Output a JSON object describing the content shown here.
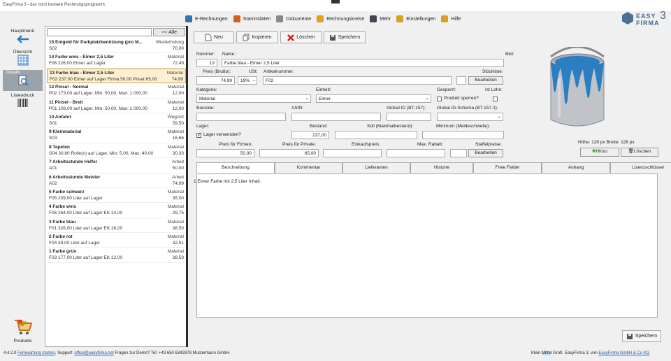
{
  "window": {
    "title": "EasyFirma 3 - das noch bessere Rechnungsprogramm"
  },
  "topmenu": [
    {
      "label": "E-Rechnungen",
      "icon": "e-invoice-icon",
      "color": "#3a6fb0"
    },
    {
      "label": "Stammdaten",
      "icon": "master-data-icon",
      "color": "#d06020"
    },
    {
      "label": "Dokumente",
      "icon": "documents-icon",
      "color": "#888"
    },
    {
      "label": "Rechnungskreise",
      "icon": "number-circle-icon",
      "color": "#e0a020"
    },
    {
      "label": "Mehr",
      "icon": "more-icon",
      "color": "#445"
    },
    {
      "label": "Einstellungen",
      "icon": "settings-icon",
      "color": "#d8a020"
    },
    {
      "label": "Hilfe",
      "icon": "help-icon",
      "color": "#d8a020"
    }
  ],
  "logo": {
    "text1": "EASY",
    "text2": "FIRMA",
    "num": "3"
  },
  "nav": {
    "hauptmenu": "Hauptmenü",
    "uebersicht": "Übersicht",
    "details": "Details",
    "listendruck": "Listendruck",
    "produkte": "Produkte"
  },
  "list": {
    "search_value": "",
    "alle_label": "Alle",
    "items": [
      {
        "title": "15 Entgeld für Parkplatzbenützung (pro M...",
        "cat": "Wiederholung",
        "desc": "S02",
        "price": "70,00"
      },
      {
        "title": "14 Farbe weis - Eimer 2,5 Liter",
        "cat": "Material",
        "desc": "F06 226,00 Eimer auf Lager",
        "price": "72,49"
      },
      {
        "title": "13 Farbe blau - Eimer 2,5 Liter",
        "cat": "Material",
        "desc": "F02 237,00 Eimer auf Lager Firma 50,00   Privat 65,00",
        "price": "74,99",
        "selected": true
      },
      {
        "title": "12 Pinsel - Normal",
        "cat": "Material",
        "desc": "P02 173,00 auf Lager, Min: 50,00, Max: 1.000,00",
        "price": "12,00"
      },
      {
        "title": "11 Pinsel - Breit",
        "cat": "Material",
        "desc": "P01 106,00 auf Lager, Min: 50,00, Max: 1.000,00",
        "price": "12,00"
      },
      {
        "title": "10 Anfahrt",
        "cat": "Wegzeit",
        "desc": "S01",
        "price": "59,50"
      },
      {
        "title": "9 Kleinmaterial",
        "cat": "Material",
        "desc": "S03",
        "price": "16,66"
      },
      {
        "title": "8 Tapeten",
        "cat": "Material",
        "desc": "S04 30,80 Rolle(n) auf Lager, Min: 5,00, Max: 40,00",
        "price": "30,33"
      },
      {
        "title": "7 Arbeitsstunde Helfer",
        "cat": "Arbeit",
        "desc": "A01",
        "price": "50,00"
      },
      {
        "title": "6 Arbeitsstunde Meister",
        "cat": "Arbeit",
        "desc": "A02",
        "price": "74,99"
      },
      {
        "title": "5 Farbe schwarz",
        "cat": "Material",
        "desc": "F05 209,00 Liter auf Lager",
        "price": "35,00"
      },
      {
        "title": "4 Farbe weis",
        "cat": "Material",
        "desc": "F06 264,00 Liter auf Lager EK 14,00",
        "price": "29,75"
      },
      {
        "title": "3 Farbe blau",
        "cat": "Material",
        "desc": "F01 326,00 Liter auf Lager EK 16,00",
        "price": "38,50"
      },
      {
        "title": "2 Farbe rot",
        "cat": "Material",
        "desc": "F04 39,00 Liter auf Lager",
        "price": "42,51"
      },
      {
        "title": "1 Farbe grün",
        "cat": "Material",
        "desc": "F03 177,00 Liter auf Lager EK 12,00",
        "price": "38,50"
      }
    ]
  },
  "toolbar": {
    "neu": "Neu",
    "kopieren": "Kopieren",
    "loeschen": "Löschen",
    "speichern": "Speichern"
  },
  "form": {
    "nummer_label": "Nummer:",
    "nummer": "13",
    "name_label": "Name:",
    "name": "Farbe blau - Eimer 2,5 Liter",
    "bild_label": "Bild:",
    "preis_label": "Preis (Brutto):",
    "preis": "74,99",
    "ust_label": "USt:",
    "ust": "19%",
    "artnr_label": "Artikelnummer:",
    "artnr": "F02",
    "stueckliste_label": "Stückliste:",
    "bearbeiten": "Bearbeiten",
    "kategorie_label": "Kategorie:",
    "kategorie": "Material",
    "einheit_label": "Einheit:",
    "einheit": "Eimer",
    "gesperrt_label": "Gesperrt:",
    "produkt_sperren": "Produkt sperren?",
    "ist_lohn_label": "Ist Lohn:",
    "barcode_label": "Barcode:",
    "asin_label": "ASIN:",
    "global_id_label": "Global ID (BT-157):",
    "global_schema_label": "Global ID-Schema (BT-157-1):",
    "lager_label": "Lager:",
    "lager_verwenden": "Lager verwenden?",
    "bestand_label": "Bestand:",
    "bestand": "237,00",
    "soll_label": "Soll (Maximalbestand):",
    "minimum_label": "Minimum (Meldeschwelle):",
    "firmen_label": "Preis für Firmen:",
    "firmen": "50,00",
    "privat_label": "Preis für Private:",
    "privat": "65,00",
    "ek_label": "Einkaufspreis:",
    "rabatt_label": "Max. Rabatt:",
    "staffel_label": "Staffelpreise:",
    "image_size": "Höhe: 128 px Breite: 128 px",
    "hinzu": "Hinzu",
    "img_loeschen": "Löschen"
  },
  "tabs": [
    {
      "label": "Beschreibung",
      "selected": true
    },
    {
      "label": "Kommentar"
    },
    {
      "label": "Lieferanten"
    },
    {
      "label": "Historie"
    },
    {
      "label": "Freie Felder"
    },
    {
      "label": "Anhang"
    },
    {
      "label": "Lizenzschlüssel"
    }
  ],
  "description": "1 Eimer Farbe mit 2,5 Liter Inhalt.",
  "bottom_save": "Speichern",
  "status": {
    "version": "4.4.2.0",
    "fernwartung": "Fernwartung starten",
    "support": ", Support:",
    "email": "office@easyfirma.net",
    "demo": "Fragen zur Demo? Tel: +43 650 6342878 Mustermann GmbH.",
    "klein": "Klein",
    "mittel": "Mittel",
    "gross": "Groß",
    "copyright": "EasyFirma 3, von",
    "company": "EasyFirma GmbH & Co KG"
  }
}
